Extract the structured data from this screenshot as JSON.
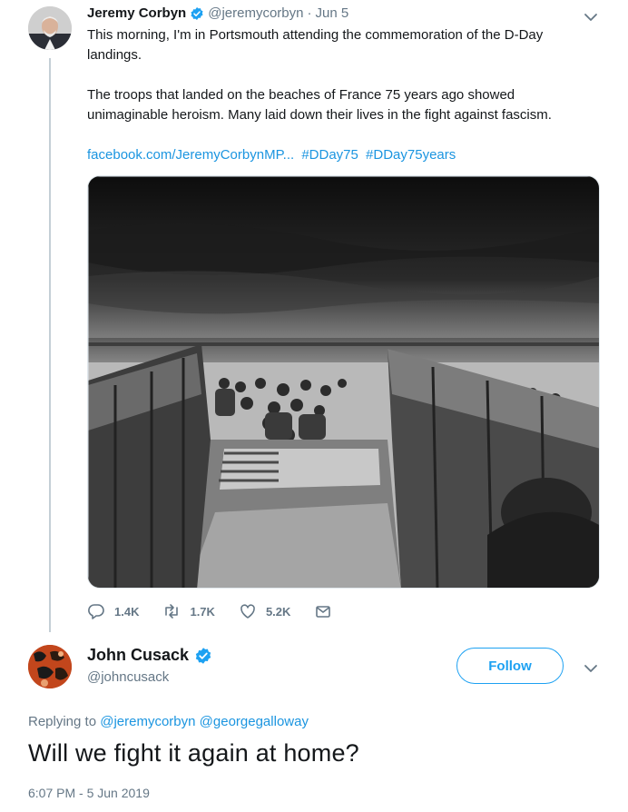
{
  "tweet1": {
    "author_name": "Jeremy Corbyn",
    "author_handle": "@jeremycorbyn",
    "separator": "·",
    "date": "Jun 5",
    "paragraph1": "This morning, I'm in Portsmouth attending the commemoration of the D-Day landings.",
    "paragraph2": "The troops that landed on the beaches of France 75 years ago showed unimaginable heroism. Many laid down their lives in the fight against fascism.",
    "link": "facebook.com/JeremyCorbynMP...",
    "hashtag1": "#DDay75",
    "hashtag2": "#DDay75years",
    "reply_count": "1.4K",
    "retweet_count": "1.7K",
    "like_count": "5.2K",
    "verified_icon": "verified-badge-icon",
    "media_description": "photo-dday-landing-craft"
  },
  "tweet2": {
    "author_name": "John Cusack",
    "author_handle": "@johncusack",
    "follow_label": "Follow",
    "replying_prefix": "Replying to",
    "reply_to_1": "@jeremycorbyn",
    "reply_to_2": "@georgegalloway",
    "text": "Will we fight it again at home?",
    "timestamp": "6:07 PM - 5 Jun 2019"
  },
  "colors": {
    "accent": "#1da1f2",
    "link": "#1b95e0",
    "secondary_text": "#657786",
    "primary_text": "#14171a",
    "thread_line": "#c4cfd6"
  }
}
